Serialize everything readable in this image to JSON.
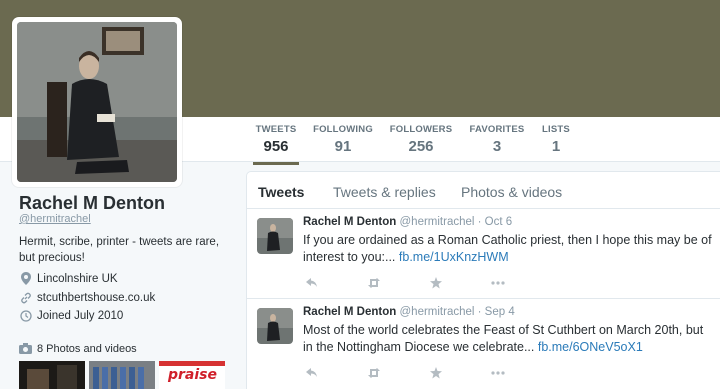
{
  "profile": {
    "name": "Rachel M Denton",
    "handle": "@hermitrachel",
    "bio": "Hermit, scribe, printer -  tweets are rare, but precious!",
    "location": "Lincolnshire UK",
    "website": "stcuthbertshouse.co.uk",
    "joined": "Joined July 2010",
    "photos_label": "8 Photos and videos"
  },
  "nav": {
    "stats": [
      {
        "label": "TWEETS",
        "value": "956"
      },
      {
        "label": "FOLLOWING",
        "value": "91"
      },
      {
        "label": "FOLLOWERS",
        "value": "256"
      },
      {
        "label": "FAVORITES",
        "value": "3"
      },
      {
        "label": "LISTS",
        "value": "1"
      }
    ]
  },
  "timeline": {
    "tabs": [
      "Tweets",
      "Tweets & replies",
      "Photos & videos"
    ],
    "tweets": [
      {
        "name": "Rachel M Denton",
        "handle": "@hermitrachel",
        "date": "· Oct 6",
        "text": "If you are ordained as a Roman Catholic priest, then I hope this may be of interest to you:... ",
        "link": "fb.me/1UxKnzHWM"
      },
      {
        "name": "Rachel M Denton",
        "handle": "@hermitrachel",
        "date": "· Sep 4",
        "text": "Most of the world celebrates the Feast of St Cuthbert on March 20th, but in the Nottingham Diocese we celebrate... ",
        "link": "fb.me/6ONeV5oX1"
      }
    ]
  },
  "thumbs": {
    "third_caption": "praise"
  },
  "colors": {
    "header_banner": "#6b6a50",
    "link": "#2b7bb9",
    "muted": "#8899a6"
  }
}
